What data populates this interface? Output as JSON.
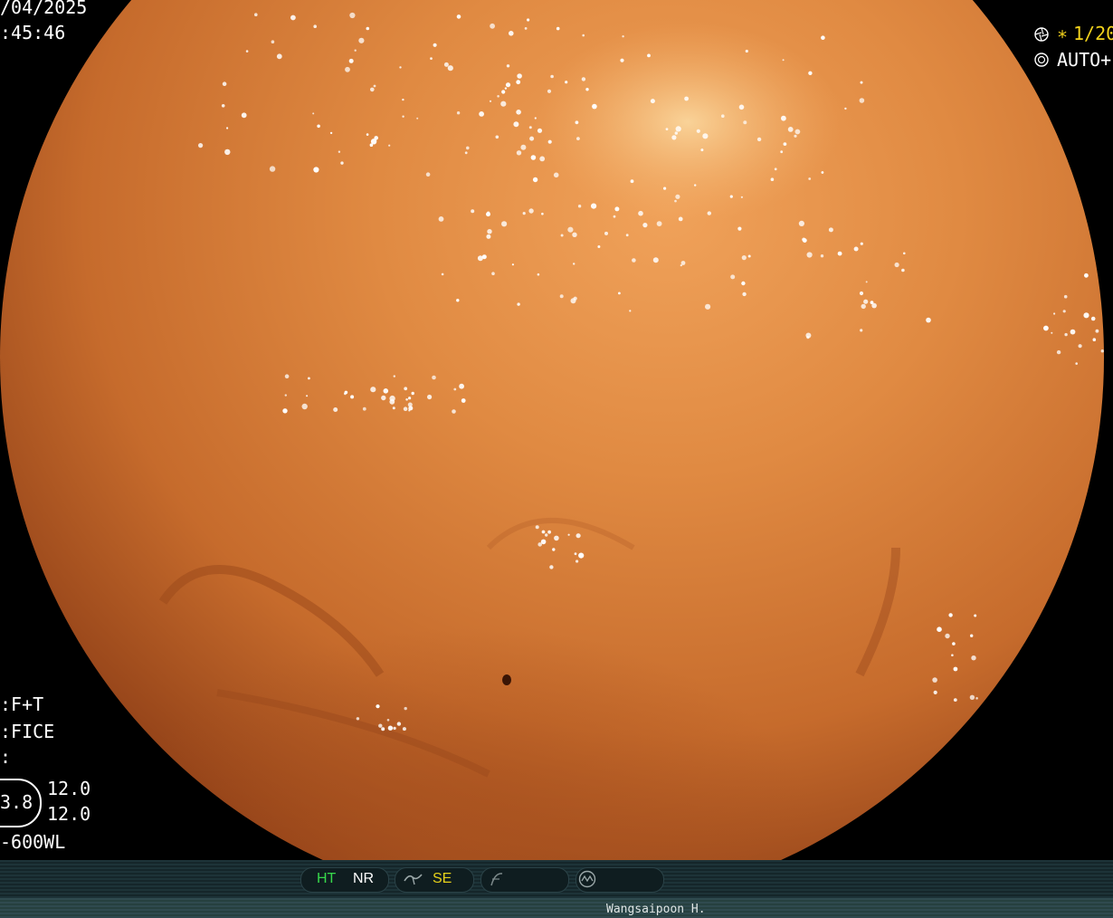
{
  "overlay": {
    "date": "/04/2025",
    "time": ":45:46",
    "shutter": "1/20",
    "shutter_star": "∗",
    "iris": "AUTO+",
    "mode_line1": ":F+T",
    "mode_line2": ":FICE",
    "mode_line3": ":",
    "zoom_value": "3.8",
    "param_a": "12.0",
    "param_b": "12.0",
    "scope_model": "-600WL"
  },
  "status_bar": {
    "ht": "HT",
    "nr": "NR",
    "se": "SE",
    "ht_color": "#37d84b",
    "se_color": "#e6d21a"
  },
  "operator": {
    "name": "Wangsaipoon H."
  },
  "colors": {
    "tissue": "#d7823e",
    "tissue_dark": "#a54d1f",
    "highlight": "#ffffff"
  },
  "icons": {
    "shutter": "shutter-icon",
    "iris": "iris-icon",
    "sharpness": "sharpness-icon",
    "frequency": "frequency-icon",
    "waveform": "waveform-icon"
  }
}
